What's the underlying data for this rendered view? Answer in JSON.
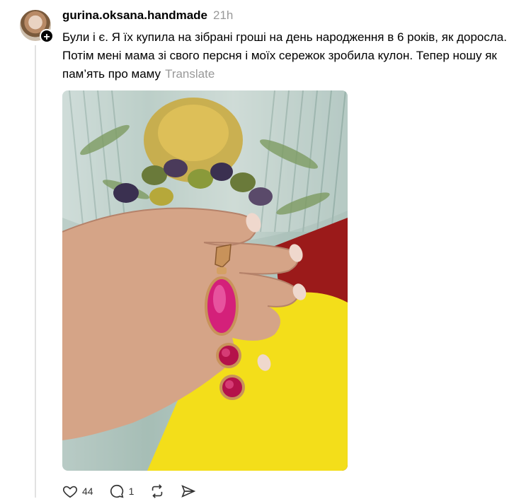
{
  "post": {
    "username": "gurina.oksana.handmade",
    "timestamp": "21h",
    "text": "Були і є. Я їх купила на зібрані гроші на день народження в 6 років, як доросла. Потім мені мама зі свого персня і моїх сережок зробила кулон. Тепер ношу як пам’ять про маму",
    "translate_label": "Translate",
    "follow_symbol": "+"
  },
  "actions": {
    "likes": "44",
    "comments": "1"
  },
  "icons": {
    "like": "heart-icon",
    "comment": "comment-icon",
    "repost": "repost-icon",
    "share": "share-icon",
    "follow": "plus-icon"
  },
  "colors": {
    "text": "#000000",
    "muted": "#999999",
    "gem": "#d4207a"
  }
}
